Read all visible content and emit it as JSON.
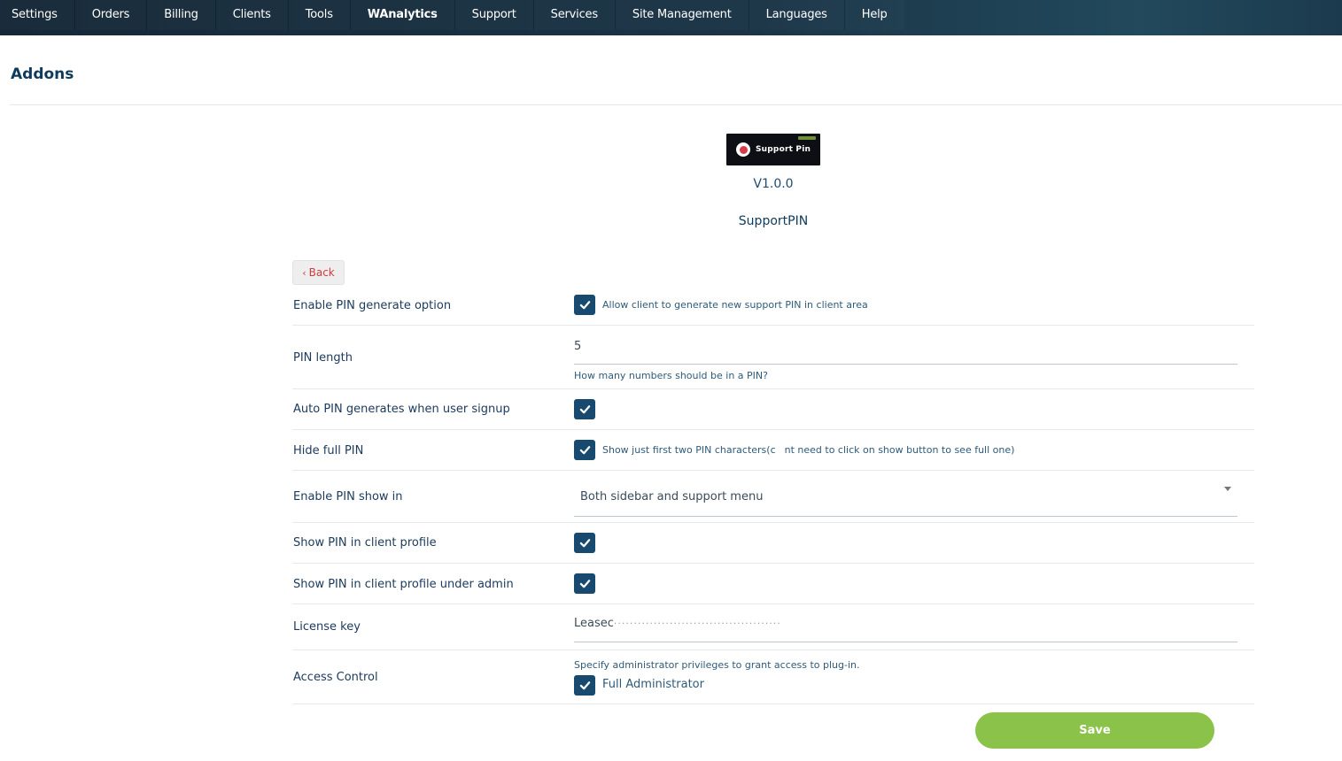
{
  "nav": {
    "items": [
      "Settings",
      "Orders",
      "Billing",
      "Clients",
      "Tools",
      "WAnalytics",
      "Support",
      "Services",
      "Site Management",
      "Languages",
      "Help"
    ]
  },
  "page": {
    "title": "Addons"
  },
  "addon": {
    "logo_text": "Support Pin",
    "version": "V1.0.0",
    "name": "SupportPIN"
  },
  "back_label": "Back",
  "settings": {
    "enable_pin_generate": {
      "label": "Enable PIN generate option",
      "checked": true,
      "help": "Allow client to generate new support PIN in client area"
    },
    "pin_length": {
      "label": "PIN length",
      "value": "5",
      "help": "How many numbers should be in a PIN?"
    },
    "auto_pin": {
      "label": "Auto PIN generates when user signup",
      "checked": true
    },
    "hide_full_pin": {
      "label": "Hide full PIN",
      "checked": true,
      "help_part1": "Show just first two PIN characters(c",
      "help_part2": "nt need to click on show button to see full one)"
    },
    "pin_show_in": {
      "label": "Enable PIN show in",
      "selected": "Both sidebar and support menu"
    },
    "show_in_profile": {
      "label": "Show PIN in client profile",
      "checked": true
    },
    "show_in_profile_admin": {
      "label": "Show PIN in client profile under admin",
      "checked": true
    },
    "license_key": {
      "label": "License key",
      "value_visible": "Leasec",
      "value_masked": "··········································"
    },
    "access_control": {
      "label": "Access Control",
      "help": "Specify administrator privileges to grant access to plug-in.",
      "option_label": "Full Administrator",
      "checked": true
    }
  },
  "save_label": "Save",
  "colors": {
    "nav_bg": "#1a3446",
    "checkbox": "#174a6e",
    "save": "#8bc34a",
    "back_text": "#d43b3b"
  }
}
